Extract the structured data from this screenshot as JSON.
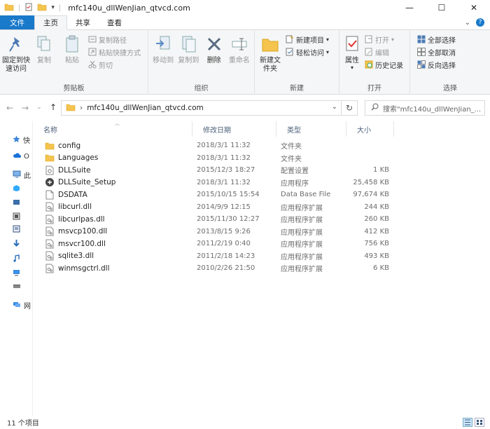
{
  "window": {
    "title": "mfc140u_dllWenJian_qtvcd.com",
    "minimize_glyph": "—",
    "maximize_glyph": "☐",
    "close_glyph": "✕"
  },
  "ribbon_tabs": [
    {
      "label": "文件"
    },
    {
      "label": "主页"
    },
    {
      "label": "共享"
    },
    {
      "label": "查看"
    }
  ],
  "ribbon": {
    "clipboard": {
      "pin": "固定到快速访问",
      "copy": "复制",
      "paste": "粘贴",
      "copy_path": "复制路径",
      "paste_shortcut": "粘贴快捷方式",
      "cut": "剪切",
      "label": "剪贴板"
    },
    "organize": {
      "move_to": "移动到",
      "copy_to": "复制到",
      "delete": "删除",
      "rename": "重命名",
      "label": "组织"
    },
    "new": {
      "new_folder": "新建文件夹",
      "new_item": "新建项目",
      "easy_access": "轻松访问",
      "label": "新建"
    },
    "open": {
      "properties": "属性",
      "open": "打开",
      "edit": "编辑",
      "history": "历史记录",
      "label": "打开"
    },
    "select": {
      "select_all": "全部选择",
      "select_none": "全部取消",
      "invert": "反向选择",
      "label": "选择"
    }
  },
  "address": {
    "path": "mfc140u_dllWenJian_qtvcd.com",
    "search_placeholder": "搜索\"mfc140u_dllWenJian_..."
  },
  "nav_pane": [
    {
      "label": "快",
      "icon": "star-icon"
    },
    {
      "label": "O",
      "icon": "cloud-icon"
    },
    {
      "label": "此",
      "icon": "computer-icon"
    },
    {
      "label": "",
      "icon": "cube-icon"
    },
    {
      "label": "",
      "icon": "video-icon"
    },
    {
      "label": "",
      "icon": "picture-icon"
    },
    {
      "label": "",
      "icon": "document-icon"
    },
    {
      "label": "",
      "icon": "download-icon"
    },
    {
      "label": "",
      "icon": "music-icon"
    },
    {
      "label": "",
      "icon": "desktop-icon"
    },
    {
      "label": "",
      "icon": "drive-icon"
    },
    {
      "label": "网",
      "icon": "network-icon"
    }
  ],
  "columns": {
    "name": "名称",
    "modified": "修改日期",
    "type": "类型",
    "size": "大小"
  },
  "files": [
    {
      "name": "config",
      "modified": "2018/3/1 11:32",
      "type": "文件夹",
      "size": "",
      "icon": "folder-icon"
    },
    {
      "name": "Languages",
      "modified": "2018/3/1 11:32",
      "type": "文件夹",
      "size": "",
      "icon": "folder-icon"
    },
    {
      "name": "DLLSuite",
      "modified": "2015/12/3 18:27",
      "type": "配置设置",
      "size": "1 KB",
      "icon": "config-file-icon"
    },
    {
      "name": "DLLSuite_Setup",
      "modified": "2018/3/1 11:32",
      "type": "应用程序",
      "size": "25,458 KB",
      "icon": "app-icon"
    },
    {
      "name": "DSDATA",
      "modified": "2015/10/15 15:54",
      "type": "Data Base File",
      "size": "97,674 KB",
      "icon": "file-icon"
    },
    {
      "name": "libcurl.dll",
      "modified": "2014/9/9 12:15",
      "type": "应用程序扩展",
      "size": "244 KB",
      "icon": "dll-icon"
    },
    {
      "name": "libcurlpas.dll",
      "modified": "2015/11/30 12:27",
      "type": "应用程序扩展",
      "size": "260 KB",
      "icon": "dll-icon"
    },
    {
      "name": "msvcp100.dll",
      "modified": "2013/8/15 9:26",
      "type": "应用程序扩展",
      "size": "412 KB",
      "icon": "dll-icon"
    },
    {
      "name": "msvcr100.dll",
      "modified": "2011/2/19 0:40",
      "type": "应用程序扩展",
      "size": "756 KB",
      "icon": "dll-icon"
    },
    {
      "name": "sqlite3.dll",
      "modified": "2011/2/18 14:23",
      "type": "应用程序扩展",
      "size": "493 KB",
      "icon": "dll-icon"
    },
    {
      "name": "winmsgctrl.dll",
      "modified": "2010/2/26 21:50",
      "type": "应用程序扩展",
      "size": "6 KB",
      "icon": "dll-icon"
    }
  ],
  "status": {
    "count": "11 个项目"
  },
  "colors": {
    "accent": "#1979ca",
    "folder": "#f4c44e"
  }
}
